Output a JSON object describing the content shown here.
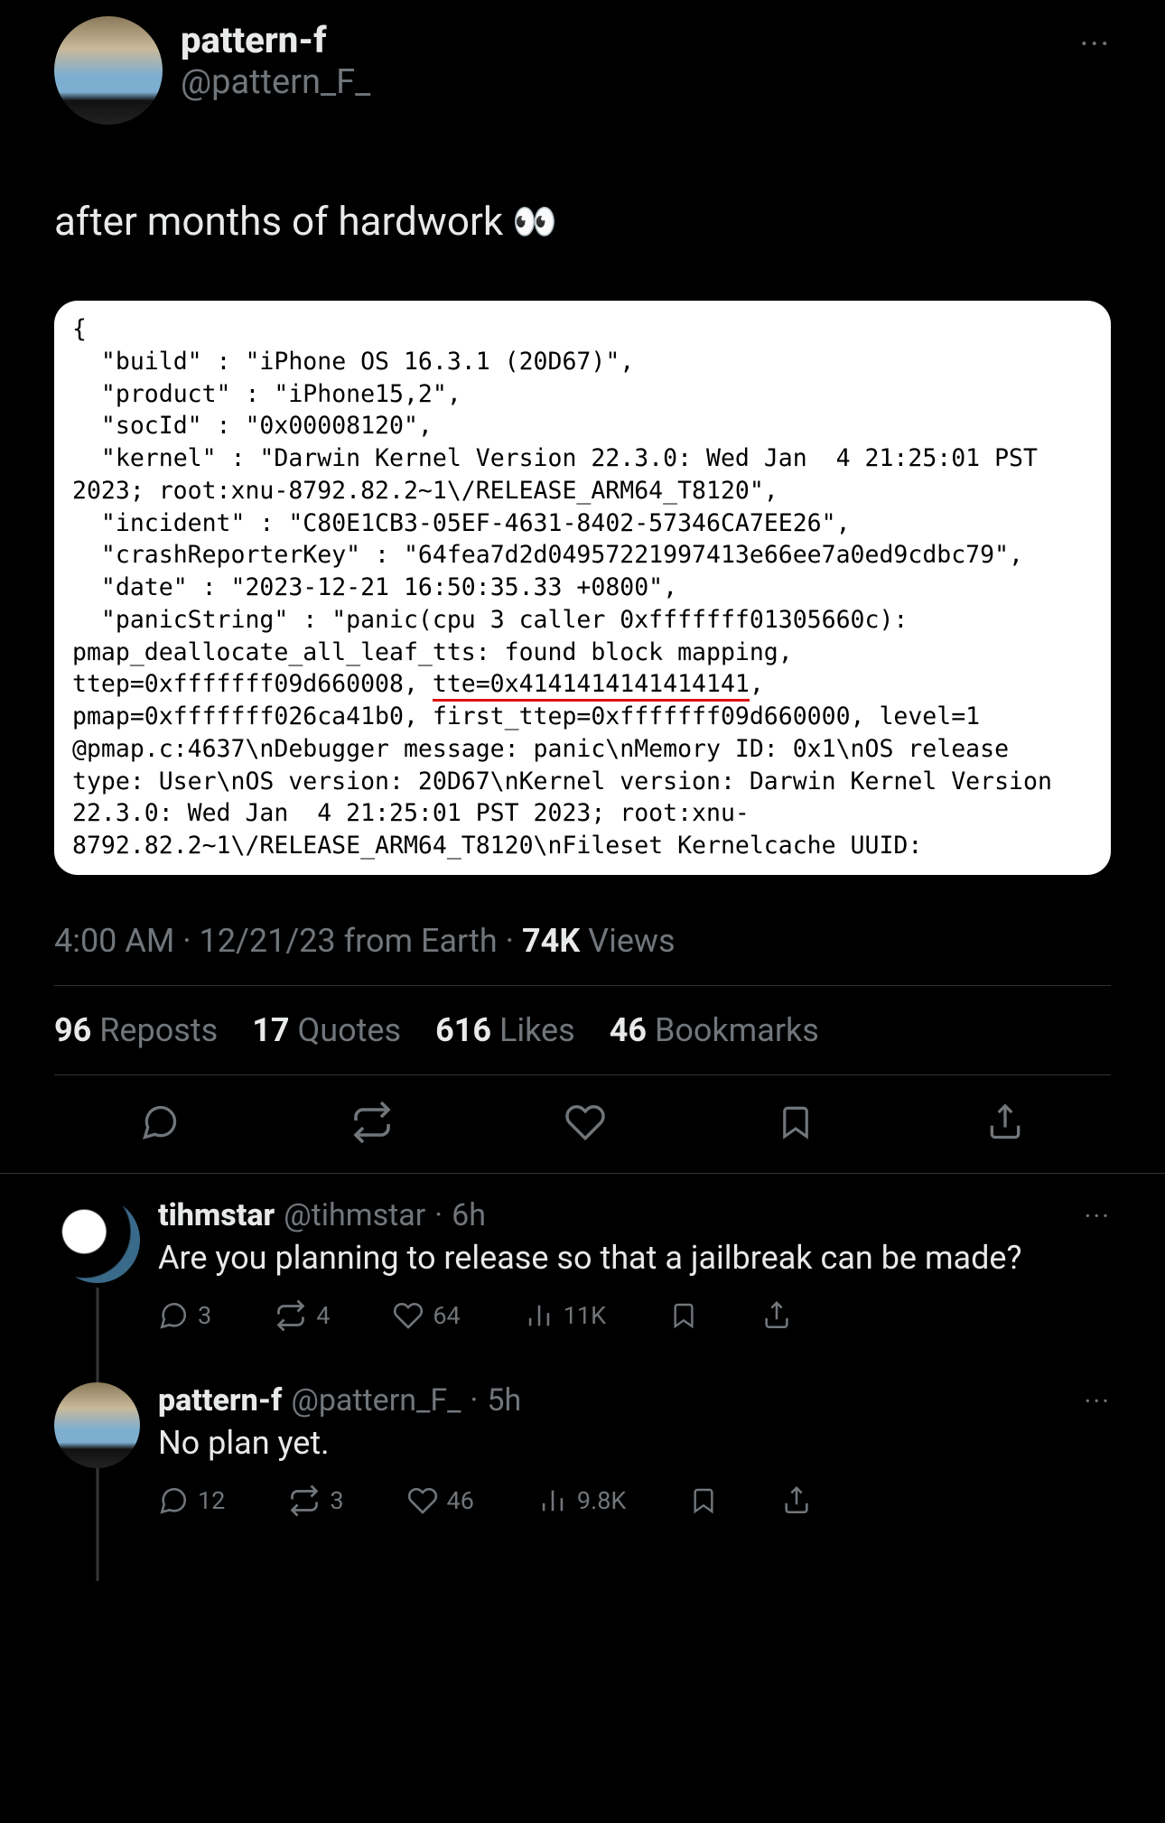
{
  "main_tweet": {
    "author": {
      "display_name": "pattern-f",
      "handle": "@pattern_F_"
    },
    "body_text": "after months of hardwork",
    "body_emoji": "👀",
    "meta": {
      "time": "4:00 AM",
      "date": "12/21/23",
      "from_label": "from",
      "location": "Earth",
      "views_count": "74K",
      "views_label": "Views"
    },
    "stats": {
      "reposts_count": "96",
      "reposts_label": "Reposts",
      "quotes_count": "17",
      "quotes_label": "Quotes",
      "likes_count": "616",
      "likes_label": "Likes",
      "bookmarks_count": "46",
      "bookmarks_label": "Bookmarks"
    },
    "media_json": {
      "pre": "{\n  \"build\" : \"iPhone OS 16.3.1 (20D67)\",\n  \"product\" : \"iPhone15,2\",\n  \"socId\" : \"0x00008120\",\n  \"kernel\" : \"Darwin Kernel Version 22.3.0: Wed Jan  4 21:25:01 PST 2023; root:xnu-8792.82.2~1\\/RELEASE_ARM64_T8120\",\n  \"incident\" : \"C80E1CB3-05EF-4631-8402-57346CA7EE26\",\n  \"crashReporterKey\" : \"64fea7d2d04957221997413e66ee7a0ed9cdbc79\",\n  \"date\" : \"2023-12-21 16:50:35.33 +0800\",\n  \"panicString\" : \"panic(cpu 3 caller 0xfffffff01305660c): pmap_deallocate_all_leaf_tts: found block mapping, ttep=0xfffffff09d660008, ",
      "underlined": "tte=0x4141414141414141",
      "post": ", pmap=0xfffffff026ca41b0, first_ttep=0xfffffff09d660000, level=1 @pmap.c:4637\\nDebugger message: panic\\nMemory ID: 0x1\\nOS release type: User\\nOS version: 20D67\\nKernel version: Darwin Kernel Version 22.3.0: Wed Jan  4 21:25:01 PST 2023; root:xnu-8792.82.2~1\\/RELEASE_ARM64_T8120\\nFileset Kernelcache UUID:"
    }
  },
  "replies": [
    {
      "author": {
        "display_name": "tihmstar",
        "handle": "@tihmstar",
        "time": "6h"
      },
      "body": "Are you planning to release so that a jailbreak can be made?",
      "actions": {
        "replies": "3",
        "reposts": "4",
        "likes": "64",
        "views": "11K"
      }
    },
    {
      "author": {
        "display_name": "pattern-f",
        "handle": "@pattern_F_",
        "time": "5h"
      },
      "body": "No plan yet.",
      "actions": {
        "replies": "12",
        "reposts": "3",
        "likes": "46",
        "views": "9.8K"
      }
    }
  ]
}
